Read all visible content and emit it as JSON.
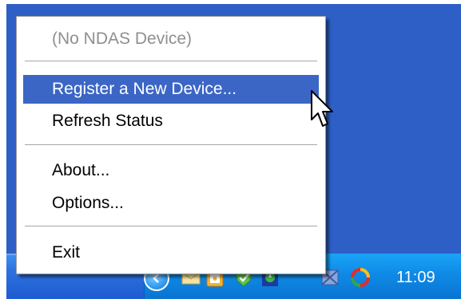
{
  "menu": {
    "items": [
      {
        "label": "(No NDAS Device)",
        "enabled": false
      },
      {
        "label": "Register a New Device...",
        "highlighted": true
      },
      {
        "label": "Refresh Status"
      },
      {
        "label": "About..."
      },
      {
        "label": "Options..."
      },
      {
        "label": "Exit"
      }
    ],
    "highlight_color": "#3c66c5"
  },
  "taskbar": {
    "clock": "11:09",
    "tray_icons": [
      "show-hidden-icons-icon",
      "mail-icon",
      "clipboard-icon",
      "security-shield-icon",
      "network-shield-icon",
      "ndas-icon",
      "swirl-app-icon"
    ]
  },
  "colors": {
    "desktop": "#2e5fc6",
    "tray": "#0f8ae6"
  }
}
